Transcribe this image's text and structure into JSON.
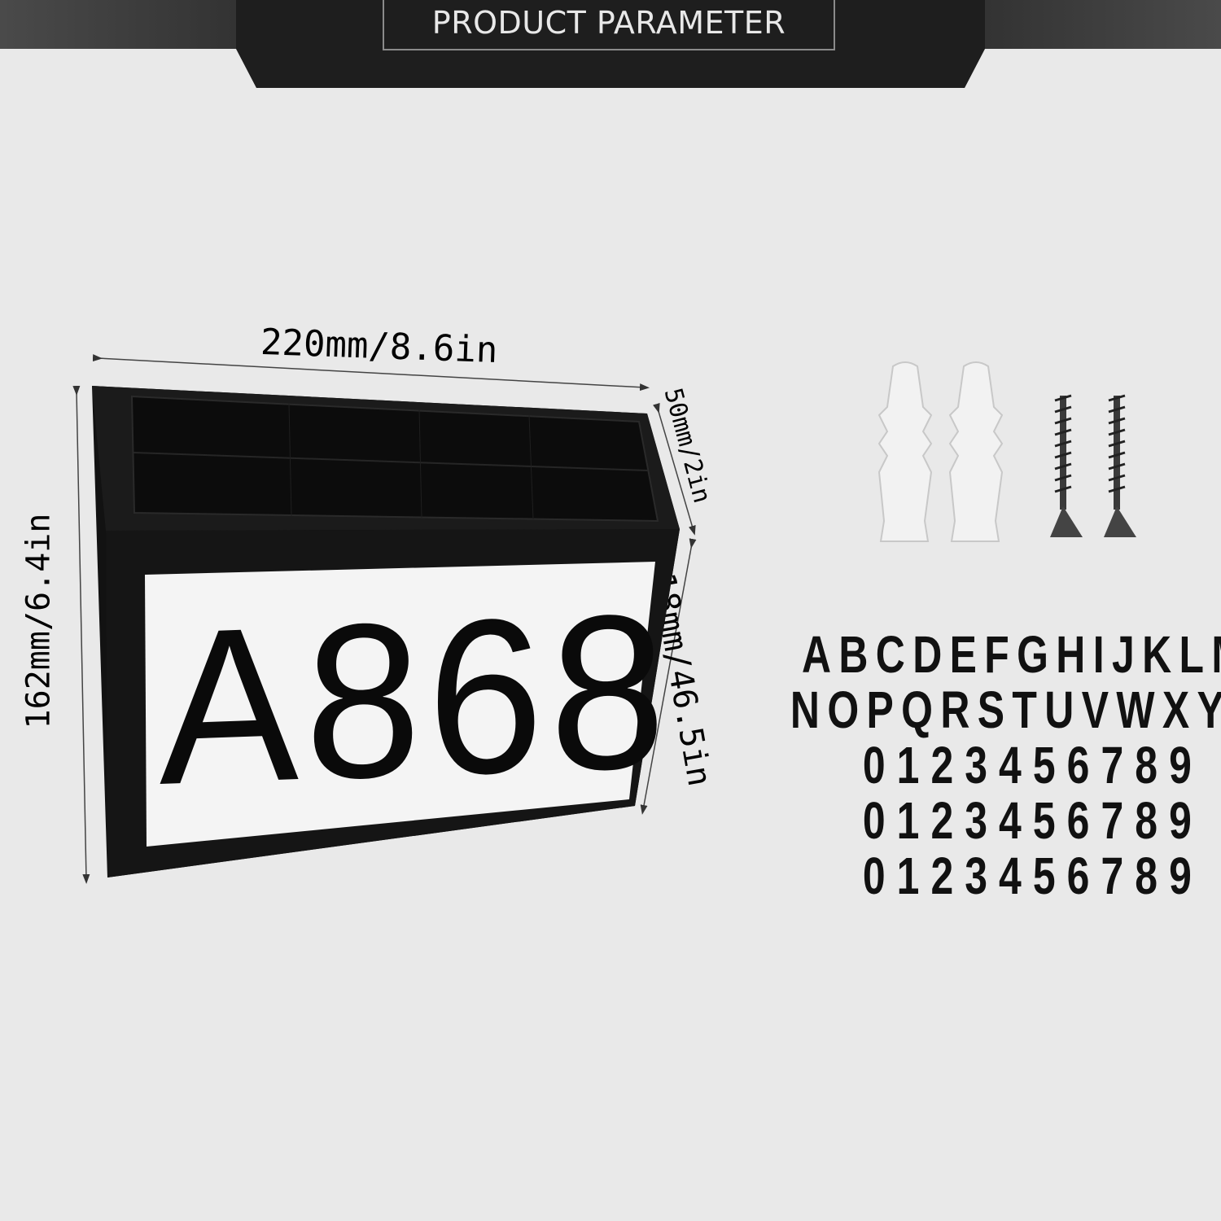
{
  "header": {
    "title": "PRODUCT PARAMETER"
  },
  "dimensions": {
    "width": "220mm/8.6in",
    "height": "162mm/6.4in",
    "depth": "50mm/2in",
    "panel_height": "118mm/46.5in"
  },
  "sign": {
    "text": "A868"
  },
  "accessories": {
    "anchors": 2,
    "screws": 2
  },
  "character_sheet": {
    "rows": [
      "ABCDEFGHIJKLM",
      "NOPQRSTUVWXYZ",
      "0123456789",
      "0123456789",
      "0123456789"
    ]
  },
  "colors": {
    "background": "#e9e9e9",
    "banner": "#1e1e1e",
    "frame": "#111111",
    "panel": "#f4f4f4"
  }
}
